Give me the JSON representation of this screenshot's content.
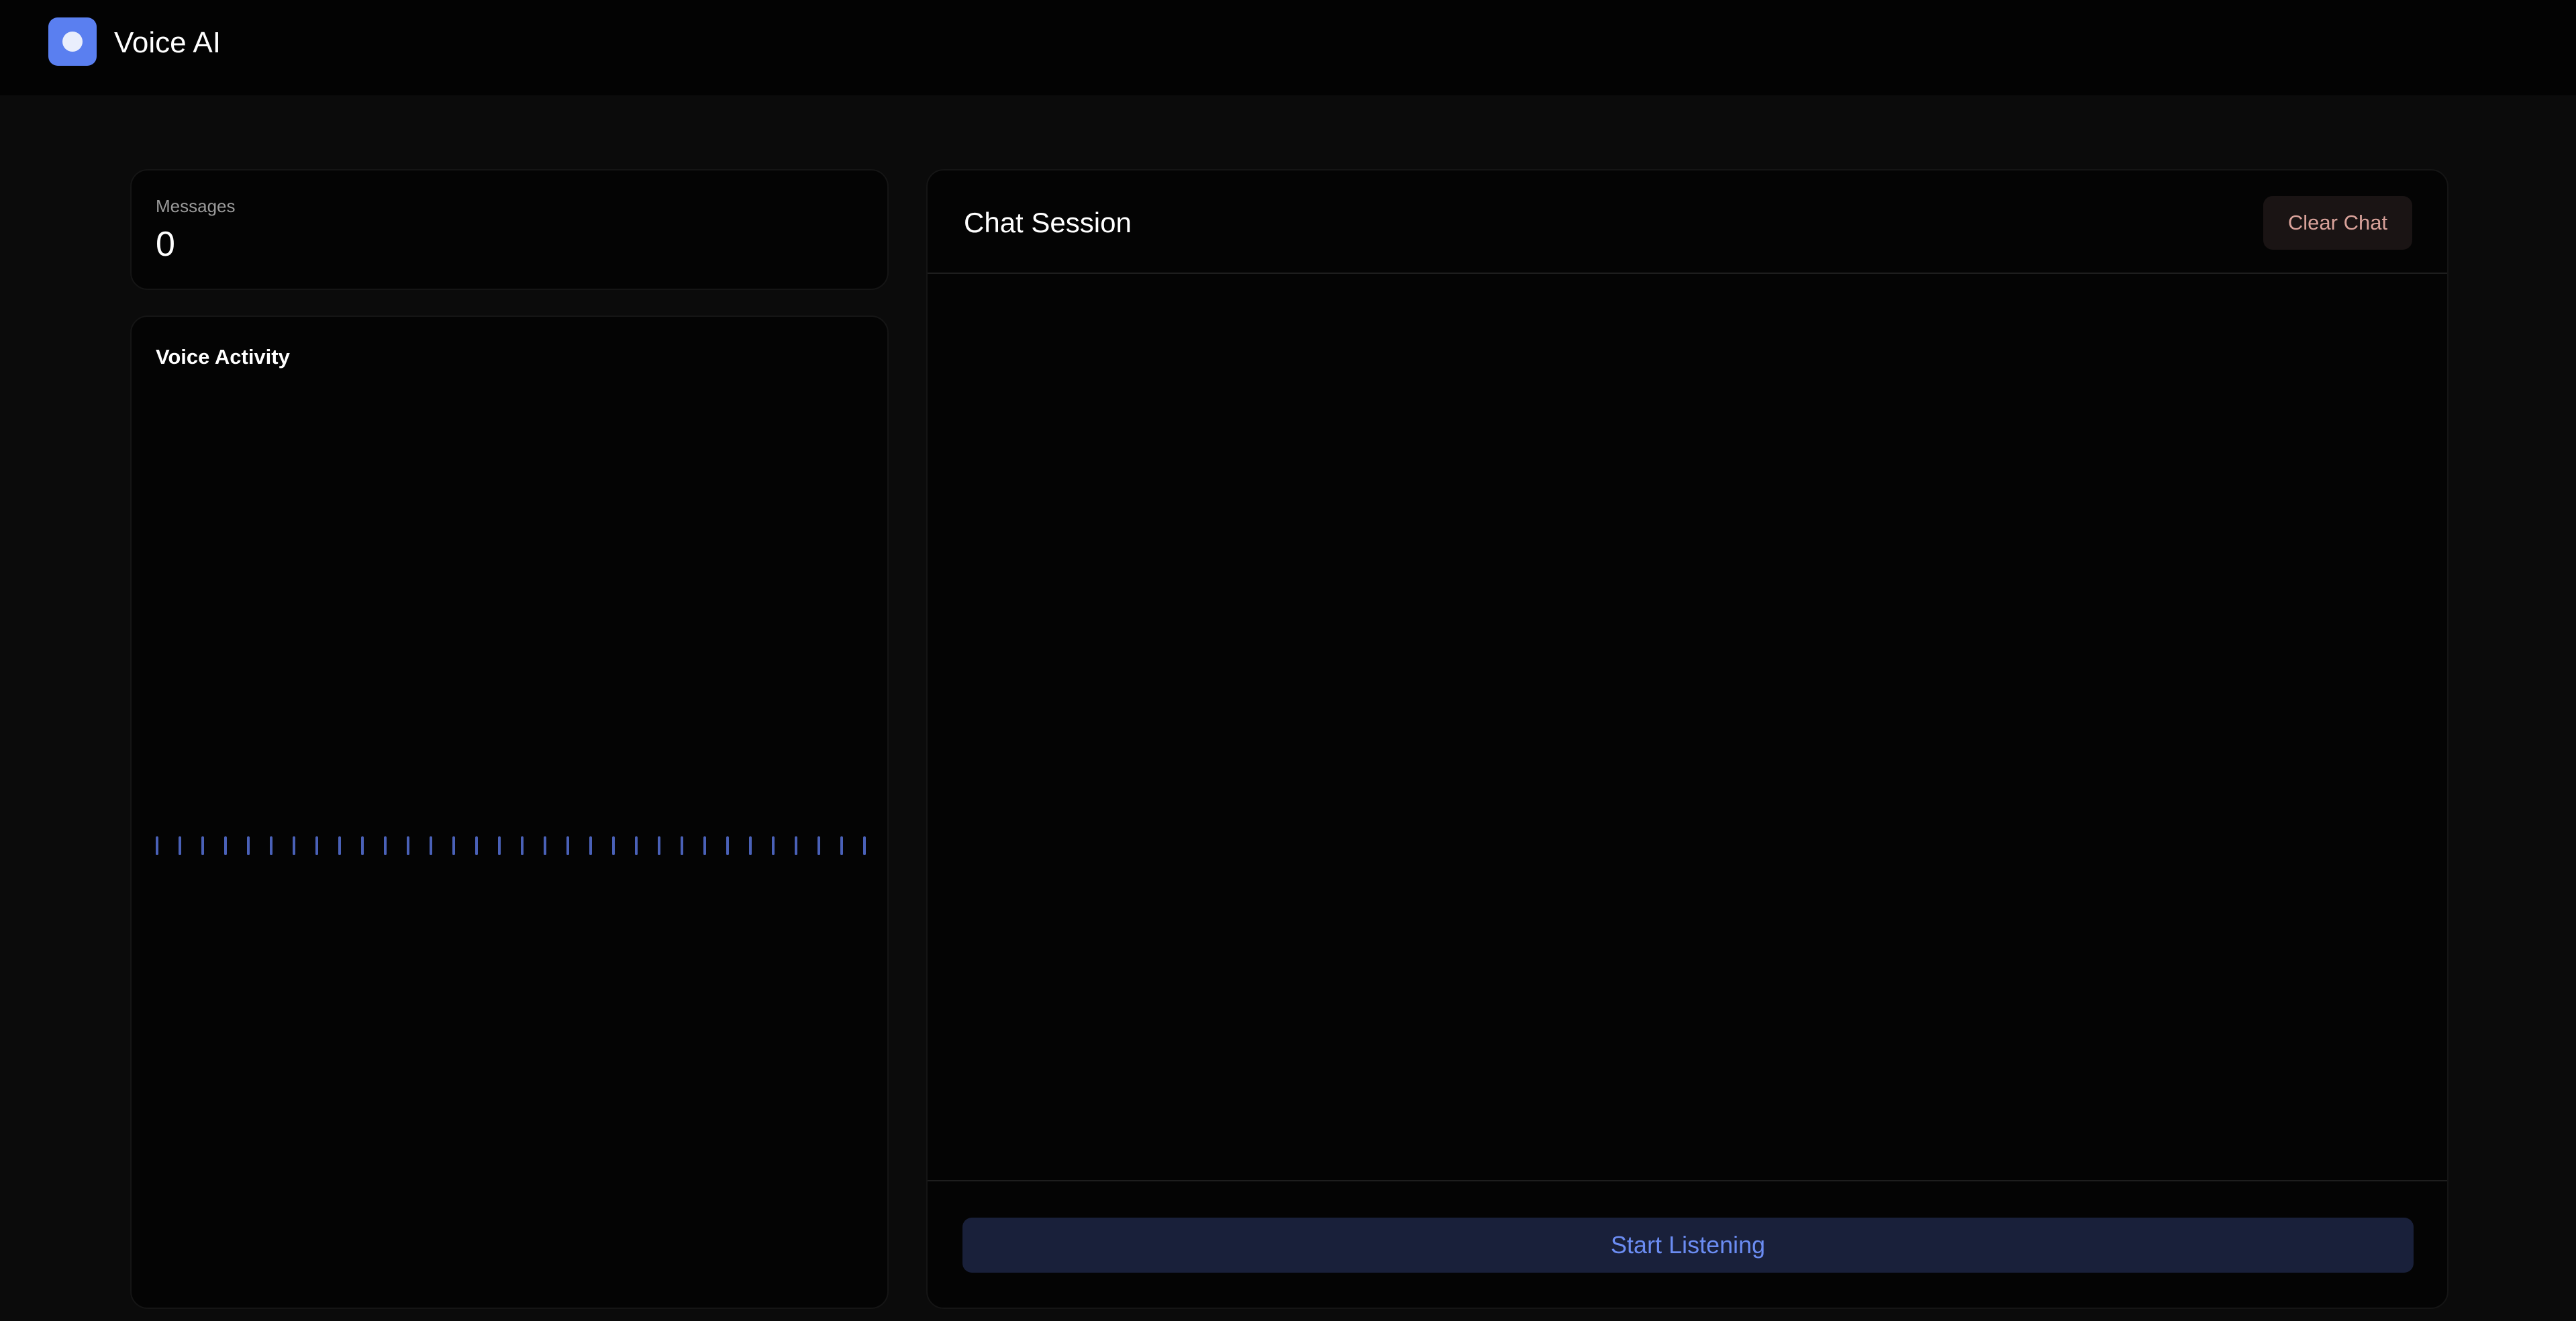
{
  "header": {
    "app_title": "Voice AI",
    "logo_icon": "record-dot-icon",
    "accent_color": "#5a7ff0"
  },
  "stats": {
    "messages_label": "Messages",
    "messages_count": "0"
  },
  "voice_activity": {
    "title": "Voice Activity",
    "bar_count": 32,
    "bar_color": "#4a61b8"
  },
  "chat": {
    "title": "Chat Session",
    "clear_label": "Clear Chat",
    "messages": [],
    "start_label": "Start Listening"
  }
}
